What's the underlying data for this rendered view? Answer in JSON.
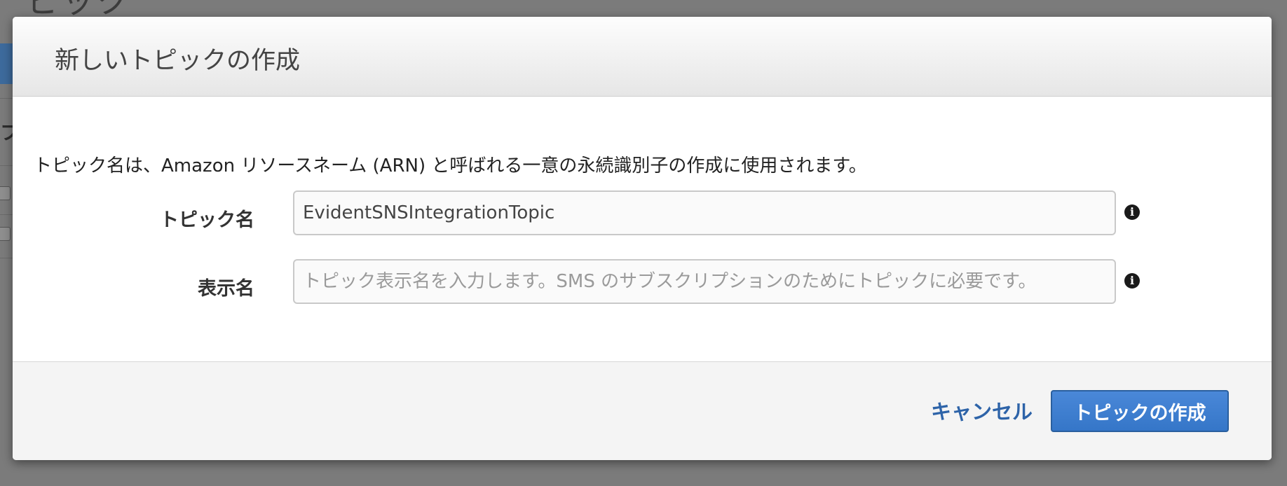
{
  "background": {
    "heading_fragment": "ピック",
    "side_fragment": "フ"
  },
  "dialog": {
    "title": "新しいトピックの作成",
    "description": "トピック名は、Amazon リソースネーム (ARN) と呼ばれる一意の永続識別子の作成に使用されます。",
    "fields": {
      "topic_name": {
        "label": "トピック名",
        "value": "EvidentSNSIntegrationTopic",
        "info_icon": "info-icon"
      },
      "display_name": {
        "label": "表示名",
        "value": "",
        "placeholder": "トピック表示名を入力します。SMS のサブスクリプションのためにトピックに必要です。",
        "info_icon": "info-icon"
      }
    },
    "footer": {
      "cancel_label": "キャンセル",
      "create_label": "トピックの作成"
    }
  },
  "colors": {
    "accent": "#3576c8",
    "link": "#2d63a8",
    "overlay": "#7b7b7b"
  }
}
